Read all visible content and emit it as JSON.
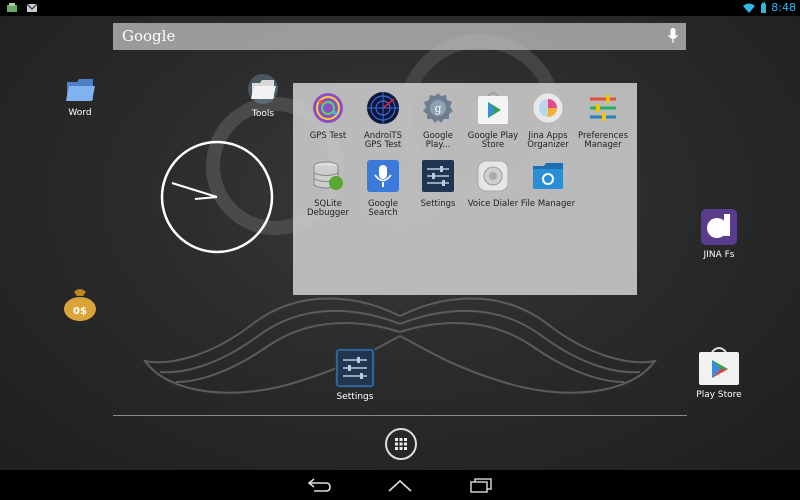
{
  "status_bar": {
    "time": "8:48",
    "icons": [
      "sync-icon",
      "gmail-icon",
      "wifi-icon",
      "battery-icon"
    ]
  },
  "search_bar": {
    "brand": "Google"
  },
  "desktop_icons": {
    "word": "Word",
    "tools": "Tools",
    "jina_fs": "JINA Fs",
    "settings": "Settings",
    "play_store": "Play Store"
  },
  "folder": {
    "apps": [
      {
        "label": "GPS Test",
        "icon": "gps-test-icon"
      },
      {
        "label": "AndroiTS GPS Test",
        "icon": "androits-icon"
      },
      {
        "label": "Google Play...",
        "icon": "google-play-services-icon"
      },
      {
        "label": "Google Play Store",
        "icon": "play-store-icon"
      },
      {
        "label": "Jina Apps Organizer",
        "icon": "jina-organizer-icon"
      },
      {
        "label": "Preferences Manager",
        "icon": "preferences-manager-icon"
      },
      {
        "label": "SQLite Debugger",
        "icon": "sqlite-icon"
      },
      {
        "label": "Google Search",
        "icon": "google-search-mic-icon"
      },
      {
        "label": "Settings",
        "icon": "settings-icon"
      },
      {
        "label": "Voice Dialer",
        "icon": "voice-dialer-icon"
      },
      {
        "label": "File Manager",
        "icon": "file-manager-icon"
      }
    ]
  },
  "colors": {
    "accent": "#33b5e5",
    "folder_bg": "#cdcdcd"
  }
}
